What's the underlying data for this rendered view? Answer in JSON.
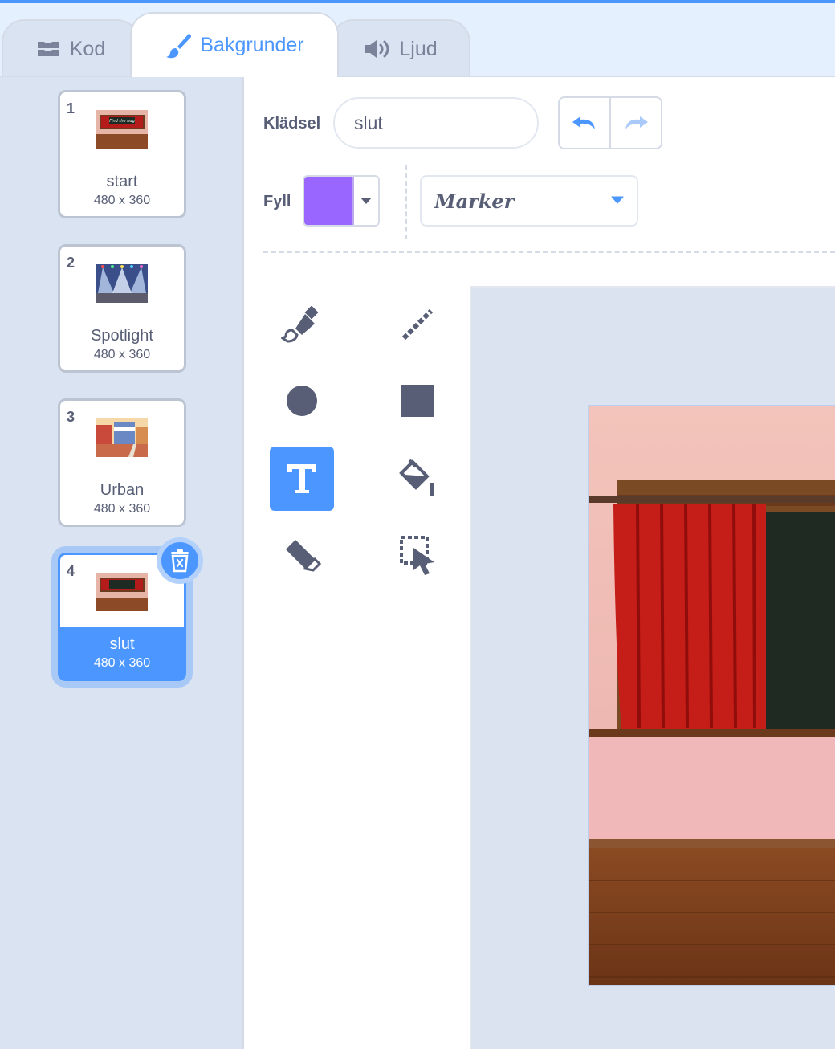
{
  "tabs": {
    "code": "Kod",
    "backdrops": "Bakgrunder",
    "sounds": "Ljud"
  },
  "backdrops": [
    {
      "number": "1",
      "name": "start",
      "size": "480 x 360"
    },
    {
      "number": "2",
      "name": "Spotlight",
      "size": "480 x 360"
    },
    {
      "number": "3",
      "name": "Urban",
      "size": "480 x 360"
    },
    {
      "number": "4",
      "name": "slut",
      "size": "480 x 360",
      "selected": true
    }
  ],
  "thumb_texts": {
    "start_sign": "Find the bug"
  },
  "editor": {
    "costume_label": "Klädsel",
    "costume_name": "slut",
    "fill_label": "Fyll",
    "fill_color": "#9966ff",
    "font": "Marker",
    "active_tool": "text-tool"
  },
  "tools": [
    "brush-icon",
    "line-icon",
    "circle-icon",
    "rectangle-icon",
    "text-icon",
    "fill-bucket-icon",
    "eraser-icon",
    "select-icon"
  ],
  "colors": {
    "accent": "#4c97ff",
    "sidebar_bg": "#d9e3f2",
    "fill": "#9966ff"
  }
}
